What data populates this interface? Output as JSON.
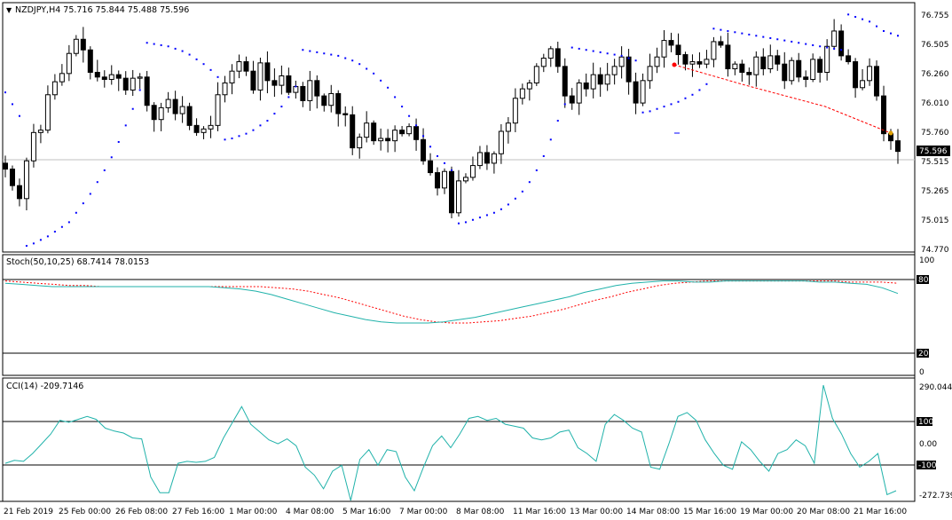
{
  "chart_data": {
    "type": "candlestick",
    "main": {
      "label": "NZDJPY,H4  75.716 75.844 75.488 75.596",
      "symbol": "NZDJPY,H4",
      "ohlc_last": [
        75.716,
        75.844,
        75.488,
        75.596
      ],
      "y_ticks": [
        "76.755",
        "76.505",
        "76.260",
        "76.010",
        "75.760",
        "75.515",
        "75.265",
        "75.015",
        "74.770"
      ],
      "current_price": "75.596",
      "close": [
        75.45,
        75.31,
        75.2,
        75.52,
        75.76,
        75.78,
        76.08,
        76.19,
        76.26,
        76.43,
        76.55,
        76.46,
        76.27,
        76.23,
        76.21,
        76.25,
        76.22,
        76.12,
        76.22,
        76.23,
        75.99,
        75.87,
        75.97,
        76.04,
        75.92,
        75.98,
        75.82,
        75.76,
        75.79,
        75.82,
        76.08,
        76.18,
        76.28,
        76.36,
        76.28,
        76.12,
        76.35,
        76.2,
        76.16,
        76.24,
        76.1,
        76.15,
        76.03,
        76.2,
        76.07,
        75.99,
        76.09,
        75.92,
        75.91,
        75.63,
        75.72,
        75.84,
        75.69,
        75.71,
        75.69,
        75.78,
        75.75,
        75.81,
        75.7,
        75.52,
        75.42,
        75.29,
        75.43,
        75.08,
        75.35,
        75.38,
        75.48,
        75.59,
        75.5,
        75.58,
        75.77,
        75.84,
        76.05,
        76.13,
        76.18,
        76.32,
        76.39,
        76.47,
        76.32,
        76.07,
        76.01,
        76.18,
        76.13,
        76.25,
        76.17,
        76.25,
        76.32,
        76.4,
        76.19,
        76.01,
        76.2,
        76.32,
        76.4,
        76.54,
        76.5,
        76.42,
        76.34,
        76.36,
        76.34,
        76.38,
        76.53,
        76.5,
        76.3,
        76.34,
        76.27,
        76.25,
        76.4,
        76.3,
        76.41,
        76.34,
        76.2,
        76.37,
        76.23,
        76.21,
        76.38,
        76.27,
        76.49,
        76.62,
        76.41,
        76.36,
        76.14,
        76.2,
        76.32,
        76.07,
        75.75,
        75.69,
        75.6
      ],
      "sar": [
        76.1,
        76.0,
        75.9,
        74.8,
        74.82,
        74.85,
        74.88,
        74.92,
        74.96,
        75.0,
        75.08,
        75.16,
        75.24,
        75.34,
        75.44,
        75.55,
        75.68,
        75.82,
        75.96,
        76.12,
        76.52,
        76.51,
        76.5,
        76.49,
        76.47,
        76.45,
        76.42,
        76.38,
        76.34,
        76.29,
        76.23,
        75.7,
        75.71,
        75.73,
        75.75,
        75.78,
        75.82,
        75.86,
        75.92,
        75.98,
        76.06,
        76.15,
        76.46,
        76.45,
        76.44,
        76.43,
        76.42,
        76.41,
        76.39,
        76.37,
        76.34,
        76.3,
        76.26,
        76.2,
        76.14,
        76.06,
        75.98,
        75.9,
        75.82,
        75.73,
        75.64,
        75.56,
        75.5,
        75.44,
        74.99,
        75.0,
        75.02,
        75.04,
        75.06,
        75.08,
        75.11,
        75.15,
        75.2,
        75.26,
        75.34,
        75.44,
        75.56,
        75.7,
        75.86,
        76.0,
        76.48,
        76.47,
        76.46,
        76.45,
        76.44,
        76.43,
        76.42,
        76.41,
        76.39,
        76.37,
        75.93,
        75.94,
        75.96,
        75.98,
        76.0,
        76.02,
        76.05,
        76.08,
        76.12,
        76.17,
        76.64,
        76.63,
        76.62,
        76.61,
        76.6,
        76.59,
        76.58,
        76.57,
        76.56,
        76.55,
        76.54,
        76.53,
        76.52,
        76.51,
        76.5,
        76.49,
        76.48,
        76.47,
        76.46,
        76.76,
        76.74,
        76.72,
        76.7,
        76.66,
        76.62,
        76.6,
        76.58
      ]
    },
    "stochastic": {
      "label": "Stoch(50,10,25) 68.7414 78.0153",
      "main": 68.7414,
      "signal": 78.0153,
      "levels": [
        80,
        20
      ],
      "scale": [
        "100",
        "80",
        "20",
        "0"
      ],
      "main_color": "#20b2aa",
      "signal_color": "#ff0000"
    },
    "cci": {
      "label": "CCI(14) -209.7146",
      "value": -209.7146,
      "levels": [
        100,
        -100
      ],
      "scale": [
        "290.0442",
        "100",
        "0.00",
        "-100",
        "-272.739"
      ],
      "color": "#20b2aa"
    },
    "x_labels": [
      "21 Feb 2019",
      "25 Feb 00:00",
      "26 Feb 08:00",
      "27 Feb 16:00",
      "1 Mar 00:00",
      "4 Mar 08:00",
      "5 Mar 16:00",
      "7 Mar 00:00",
      "8 Mar 08:00",
      "11 Mar 16:00",
      "13 Mar 00:00",
      "14 Mar 08:00",
      "15 Mar 16:00",
      "19 Mar 00:00",
      "20 Mar 08:00",
      "21 Mar 16:00"
    ]
  },
  "colors": {
    "background": "#ffffff",
    "candle": "#000000",
    "sar": "#0000ff",
    "trendline": "#ff0000"
  }
}
